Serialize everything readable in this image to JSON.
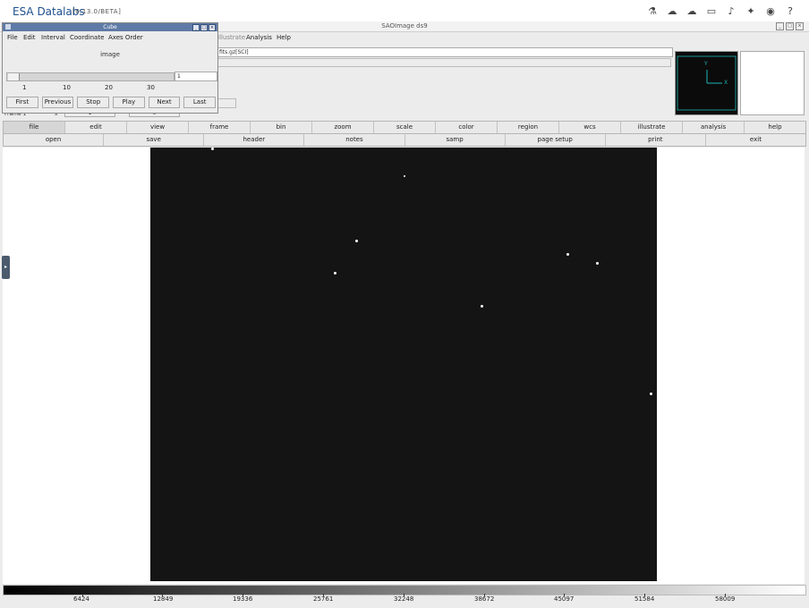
{
  "app": {
    "name": "ESA Datalabs",
    "version": "[0.13.0/BETA]"
  },
  "toolbar_icons": [
    "flask-icon",
    "cloud-stack-icon",
    "cloud-icon",
    "folder-icon",
    "bell-icon",
    "satellite-icon",
    "user-icon",
    "help-icon"
  ],
  "ds9": {
    "window_title": "SAOImage ds9",
    "menus": [
      "Illustrate",
      "Analysis",
      "Help"
    ],
    "filename": "fits.gz[SCI]",
    "frame_label": "Frame 1",
    "frame_x": "x",
    "frame_val1": "1",
    "frame_val2": "0",
    "buttons_row1": [
      "file",
      "edit",
      "view",
      "frame",
      "bin",
      "zoom",
      "scale",
      "color",
      "region",
      "wcs",
      "illustrate",
      "analysis",
      "help"
    ],
    "buttons_row2": [
      "open",
      "save",
      "header",
      "notes",
      "samp",
      "page setup",
      "print",
      "exit"
    ],
    "colorbar_ticks": [
      "6424",
      "12849",
      "19336",
      "25761",
      "32248",
      "38672",
      "45097",
      "51584",
      "58009"
    ]
  },
  "cube": {
    "title": "Cube",
    "menus": [
      "File",
      "Edit",
      "Interval",
      "Coordinate",
      "Axes Order"
    ],
    "axis_label": "image",
    "slice_value": "1",
    "slider_fraction": 0,
    "scale_labels": [
      "1",
      "10",
      "20",
      "30"
    ],
    "buttons": [
      "First",
      "Previous",
      "Stop",
      "Play",
      "Next",
      "Last"
    ]
  },
  "panner": {
    "y_label": "Y",
    "x_label": "X"
  }
}
